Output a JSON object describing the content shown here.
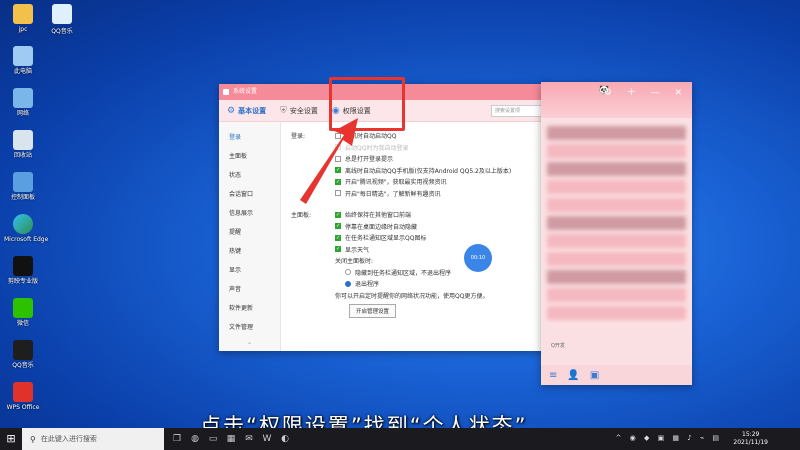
{
  "desktop": {
    "icons": [
      {
        "label": "jpc"
      },
      {
        "label": "此电脑"
      },
      {
        "label": "网络"
      },
      {
        "label": "回收站"
      },
      {
        "label": "控制面板"
      },
      {
        "label": "Microsoft Edge"
      },
      {
        "label": "剪映专业版"
      },
      {
        "label": "微信"
      },
      {
        "label": "QQ音乐"
      },
      {
        "label": "WPS Office"
      }
    ],
    "second_icon": {
      "label": "QQ音乐"
    }
  },
  "settings_window": {
    "title": "系统设置",
    "tabs": [
      {
        "label": "基本设置"
      },
      {
        "label": "安全设置"
      },
      {
        "label": "权限设置"
      }
    ],
    "search_placeholder": "搜索设置项",
    "sidebar": [
      "登录",
      "主面板",
      "状态",
      "会话窗口",
      "信息展示",
      "提醒",
      "热键",
      "显示",
      "声音",
      "软件更新",
      "文件管理"
    ],
    "login_section": {
      "label": "登录:",
      "options": [
        {
          "text": "开机时自动启动QQ",
          "checked": false
        },
        {
          "text": "启动QQ时为我自动登录",
          "checked": false,
          "disabled": true
        },
        {
          "text": "总是打开登录提示",
          "checked": false
        },
        {
          "text": "离线时自动启动QQ手机版(仅支持Android QQ5.2及以上版本)",
          "checked": true
        },
        {
          "text": "开启\"腾讯视频\"，获取最实用视频资讯",
          "checked": true
        },
        {
          "text": "开启\"每日精选\"，了解新鲜有趣资讯",
          "checked": false
        }
      ]
    },
    "panel_section": {
      "label": "主面板:",
      "options": [
        {
          "text": "始终保持在其他窗口前端",
          "checked": true
        },
        {
          "text": "停靠在桌面边缘时自动隐藏",
          "checked": true
        },
        {
          "text": "在任务栏通知区域显示QQ图标",
          "checked": true
        },
        {
          "text": "显示天气",
          "checked": true
        }
      ],
      "close_label": "关闭主面板时:",
      "radios": [
        {
          "text": "隐藏到任务栏通知区域，不退出程序",
          "checked": false
        },
        {
          "text": "退出程序",
          "checked": true
        }
      ],
      "note": "你可以开启定时提醒你的网络状况功能，使用QQ更方便。",
      "manage_button": "开启管理设置"
    },
    "floating_badge": "00:10"
  },
  "qq_panel": {
    "status_text": "Q开发"
  },
  "caption": "点击“权限设置”找到“个人状态”",
  "taskbar": {
    "search_placeholder": "在此键入进行搜索",
    "time": "15:29",
    "date": "2021/11/19"
  }
}
